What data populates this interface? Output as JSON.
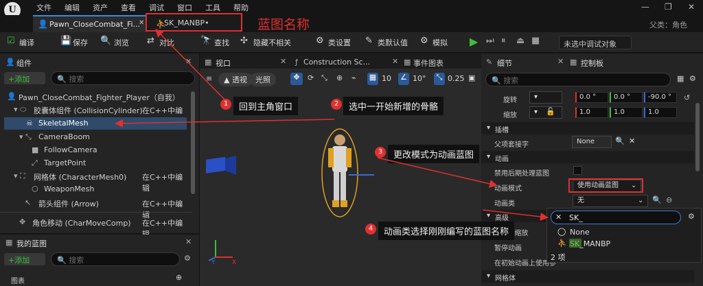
{
  "menu": [
    "文件",
    "编辑",
    "资产",
    "查看",
    "调试",
    "窗口",
    "工具",
    "帮助"
  ],
  "tabs": {
    "main": "Pawn_CloseCombat_Fi...",
    "second": "SK_MANBP•"
  },
  "parent_label": "父类：角色",
  "title_annotation": "蓝图名称",
  "toolbar": {
    "compile": "编译",
    "save": "保存",
    "browse": "浏览",
    "diff": "对比",
    "find": "查找",
    "hide_unrelated": "隐藏不相关",
    "class_settings": "类设置",
    "class_defaults": "类默认值",
    "simulate": "模拟",
    "debug_target": "未选中调试对象"
  },
  "components": {
    "title": "组件",
    "add": "+添加",
    "search_placeholder": "搜索",
    "items": [
      {
        "label": "Pawn_CloseCombat_Fighter_Player（自我）",
        "right": ""
      },
      {
        "label": "胶囊体组件 (CollisionCylinder)",
        "right": "在C++中编辑"
      },
      {
        "label": "SkeletalMesh",
        "right": ""
      },
      {
        "label": "CameraBoom",
        "right": ""
      },
      {
        "label": "FollowCamera",
        "right": ""
      },
      {
        "label": "TargetPoint",
        "right": ""
      },
      {
        "label": "网格体 (CharacterMesh0)",
        "right": "在C++中编辑"
      },
      {
        "label": "WeaponMesh",
        "right": ""
      },
      {
        "label": "箭头组件 (Arrow)",
        "right": "在C++中编辑"
      },
      {
        "label": "角色移动 (CharMoveComp)",
        "right": "在C++中编辑"
      }
    ]
  },
  "myblueprint": {
    "title": "我的蓝图",
    "add": "+添加",
    "search_placeholder": "搜索",
    "graph": "图表"
  },
  "viewport_tabs": {
    "viewport": "视口",
    "construction": "Construction Sc...",
    "event_graph": "事件图表"
  },
  "viewport_toolbar": {
    "perspective": "透视",
    "lit": "光照",
    "grid": "10",
    "angle": "10°",
    "scale": "0.25"
  },
  "details": {
    "title": "细节",
    "control_panel": "控制板",
    "search_placeholder": "搜索",
    "rotation_label": "旋转",
    "rotation": [
      "0.0 °",
      "0.0 °",
      "-90.0 °"
    ],
    "scale_label": "缩放",
    "scale": [
      "1.0",
      "1.0",
      "1.0"
    ],
    "socket_section": "插槽",
    "parent_socket_label": "父项套接字",
    "parent_socket_value": "None",
    "anim_section": "动画",
    "disable_post_label": "禁用后期处理蓝图",
    "anim_mode_label": "动画模式",
    "anim_mode_value": "使用动画蓝图",
    "anim_class_label": "动画类",
    "anim_class_value": "无",
    "advanced_section": "高级",
    "rate_label": "...画率缩放",
    "pause_label": "暂停动画",
    "init_label": "在初始动画上使用参",
    "mesh_section": "网格体"
  },
  "popup": {
    "search_value": "SK_",
    "options": [
      "None",
      "SK_MANBP"
    ],
    "count": "2 项"
  },
  "annotations": [
    {
      "num": "1",
      "text": "回到主角窗口"
    },
    {
      "num": "2",
      "text": "选中一开始新增的骨骼"
    },
    {
      "num": "3",
      "text": "更改模式为动画蓝图"
    },
    {
      "num": "4",
      "text": "动画类选择刚刚编写的蓝图名称"
    }
  ],
  "colors": {
    "annotation_red": "#e03030",
    "selection": "#2f4a6a",
    "accent_blue": "#3a8ad9",
    "play_green": "#3fbf3f"
  }
}
